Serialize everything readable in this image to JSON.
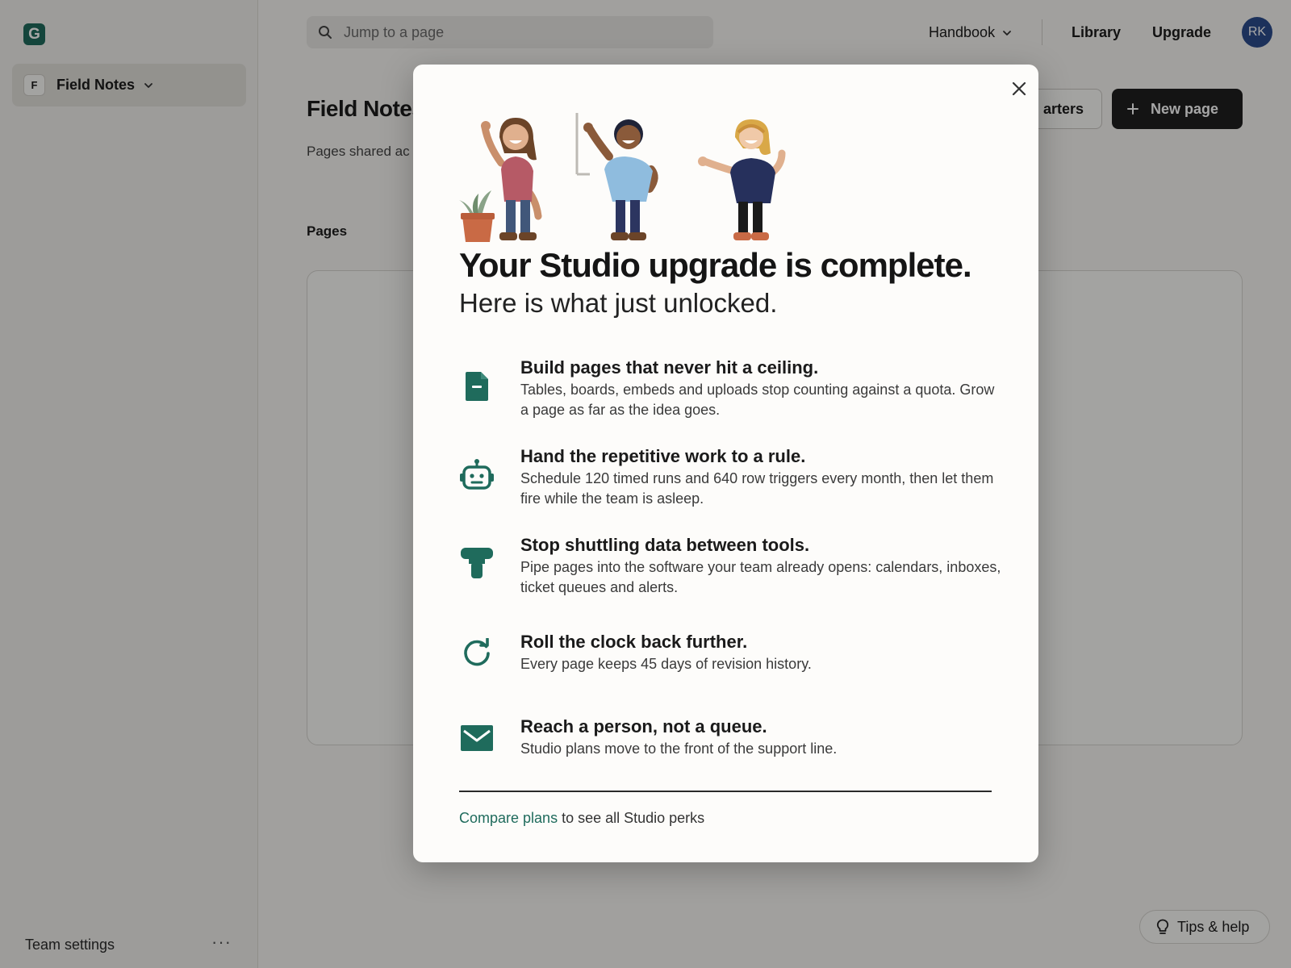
{
  "app": {
    "logo_letter": "G",
    "workspace_badge": "F",
    "workspace_name": "Field Notes",
    "team_settings": "Team settings",
    "team_more": "···"
  },
  "topbar": {
    "search_placeholder": "Jump to a page",
    "handbook": "Handbook",
    "library": "Library",
    "upgrade": "Upgrade",
    "avatar_initials": "RK"
  },
  "main": {
    "title": "Field Notes",
    "subtitle": "Pages shared ac",
    "pages_label": "Pages",
    "starters_button": "arters",
    "new_page_button": "New page",
    "tips_button": "Tips & help"
  },
  "modal": {
    "title": "Your Studio upgrade is complete.",
    "subtitle": "Here is what just unlocked.",
    "features": [
      {
        "icon": "document-icon",
        "title": "Build pages that never hit a ceiling.",
        "desc": "Tables, boards, embeds and uploads stop counting against a quota. Grow a page as far as the idea goes."
      },
      {
        "icon": "robot-icon",
        "title": "Hand the repetitive work to a rule.",
        "desc": "Schedule 120 timed runs and 640 row triggers every month, then let them fire while the team is asleep."
      },
      {
        "icon": "plug-icon",
        "title": "Stop shuttling data between tools.",
        "desc": "Pipe pages into the software your team already opens: calendars, inboxes, ticket queues and alerts."
      },
      {
        "icon": "history-icon",
        "title": "Roll the clock back further.",
        "desc": "Every page keeps 45 days of revision history."
      },
      {
        "icon": "envelope-icon",
        "title": "Reach a person, not a queue.",
        "desc": "Studio plans move to the front of the support line."
      }
    ],
    "footer_link": "Compare plans",
    "footer_text": " to see all Studio perks"
  },
  "colors": {
    "accent": "#1f6b5c",
    "icon": "#1f6b5c",
    "dark_button": "#1f1f1f",
    "avatar": "#2c4c8c"
  }
}
